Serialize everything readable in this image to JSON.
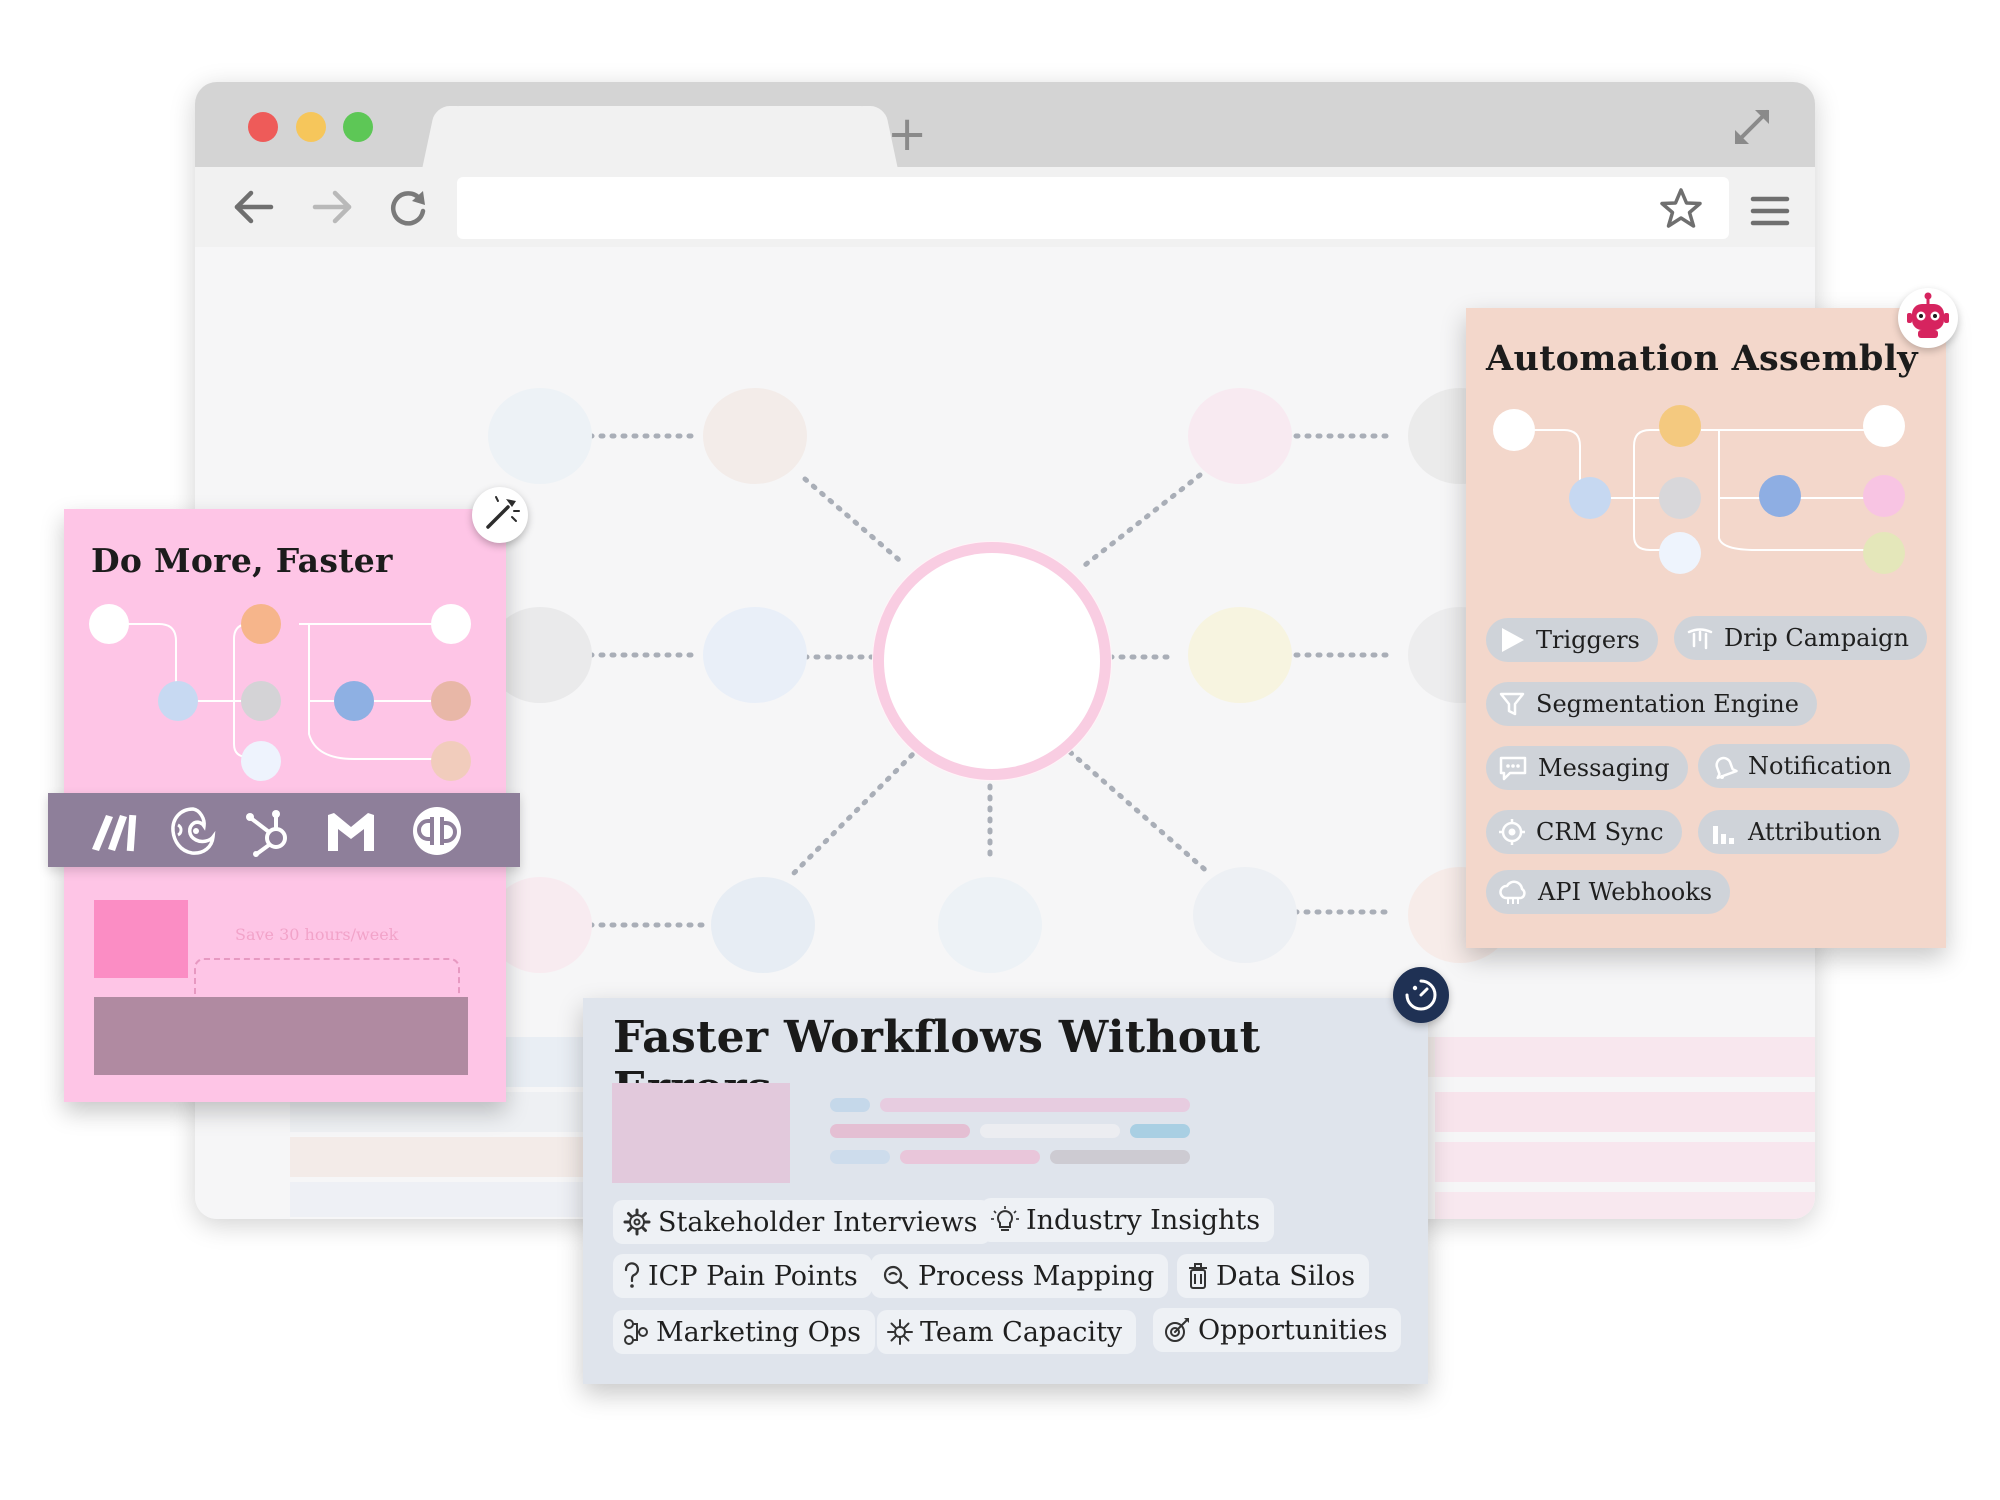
{
  "browser": {
    "new_tab_symbol": "+",
    "icons": [
      "back-arrow-icon",
      "forward-arrow-icon",
      "reload-icon",
      "star-icon",
      "menu-icon",
      "expand-icon"
    ]
  },
  "left_card": {
    "title": "Do More, Faster",
    "save_text": "Save 30 hours/week",
    "logos": [
      "make-logo-icon",
      "mailchimp-logo-icon",
      "hubspot-logo-icon",
      "gmail-logo-icon",
      "quickbooks-logo-icon"
    ],
    "colors": {
      "background": "#fec5e6",
      "logo_bar": "#8e7f9a"
    }
  },
  "right_card": {
    "title": "Automation Assembly",
    "pills": [
      {
        "label": "Triggers",
        "icon": "play-icon"
      },
      {
        "label": "Drip Campaign",
        "icon": "drip-icon"
      },
      {
        "label": "Segmentation Engine",
        "icon": "funnel-icon"
      },
      {
        "label": "Messaging",
        "icon": "chat-icon"
      },
      {
        "label": "Notification",
        "icon": "bell-icon"
      },
      {
        "label": "CRM Sync",
        "icon": "sync-icon"
      },
      {
        "label": "Attribution",
        "icon": "bar-chart-icon"
      },
      {
        "label": "API Webhooks",
        "icon": "cloud-icon"
      }
    ],
    "colors": {
      "background": "#f3d7cb",
      "pill": "#cfd3d9"
    }
  },
  "bottom_card": {
    "title": "Faster Workflows Without Errors",
    "pills": [
      {
        "label": "Stakeholder Interviews",
        "icon": "gear-icon"
      },
      {
        "label": "Industry Insights",
        "icon": "lightbulb-icon"
      },
      {
        "label": "ICP Pain Points",
        "icon": "question-icon"
      },
      {
        "label": "Process Mapping",
        "icon": "magnifier-icon"
      },
      {
        "label": "Data Silos",
        "icon": "bin-icon"
      },
      {
        "label": "Marketing Ops",
        "icon": "flow-icon"
      },
      {
        "label": "Team Capacity",
        "icon": "burst-icon"
      },
      {
        "label": "Opportunities",
        "icon": "target-icon"
      }
    ],
    "colors": {
      "background": "#dfe4ec",
      "pill": "#eef1f5"
    }
  }
}
